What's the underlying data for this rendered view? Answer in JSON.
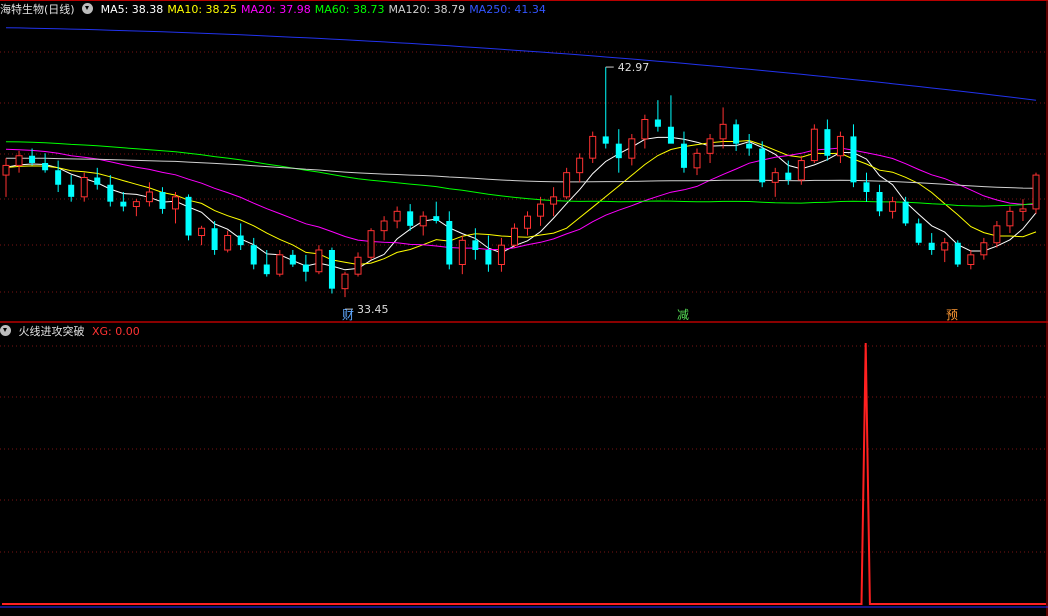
{
  "main_legend": {
    "stock": "海特生物(日线)",
    "items": [
      {
        "label": "MA5: 38.38",
        "color": "#ffffff"
      },
      {
        "label": "MA10: 38.25",
        "color": "#ffff00"
      },
      {
        "label": "MA20: 37.98",
        "color": "#ff00ff"
      },
      {
        "label": "MA60: 38.73",
        "color": "#00ff00"
      },
      {
        "label": "MA120: 38.79",
        "color": "#d0d0d0"
      },
      {
        "label": "MA250: 41.34",
        "color": "#3355ff"
      }
    ]
  },
  "sub_legend": {
    "indicator": "火线进攻突破",
    "value": "XG: 0.00",
    "value_color": "#ff3333"
  },
  "price_annotations": {
    "high": "42.97",
    "low": "33.45"
  },
  "event_markers": [
    {
      "label": "财",
      "color": "#5fa8ff"
    },
    {
      "label": "减",
      "color": "#55dd55"
    },
    {
      "label": "预",
      "color": "#ff9933"
    }
  ],
  "colors": {
    "up": "#ff3232",
    "down": "#00ffff",
    "grid": "#7a1515",
    "divider": "#b80000"
  },
  "chart_data": [
    {
      "type": "candlestick",
      "bars": 80,
      "ylim": [
        33.0,
        45.0
      ],
      "candles": [
        [
          38.5,
          39.2,
          37.6,
          38.9
        ],
        [
          38.9,
          39.5,
          38.6,
          39.3
        ],
        [
          39.3,
          39.6,
          38.9,
          39.0
        ],
        [
          39.0,
          39.4,
          38.6,
          38.7
        ],
        [
          38.7,
          39.1,
          37.8,
          38.1
        ],
        [
          38.1,
          38.5,
          37.4,
          37.6
        ],
        [
          37.6,
          38.6,
          37.4,
          38.4
        ],
        [
          38.4,
          38.8,
          37.9,
          38.1
        ],
        [
          38.1,
          38.5,
          37.2,
          37.4
        ],
        [
          37.4,
          37.8,
          37.0,
          37.2
        ],
        [
          37.2,
          37.5,
          36.8,
          37.4
        ],
        [
          37.4,
          38.2,
          37.2,
          37.8
        ],
        [
          37.8,
          38.0,
          36.9,
          37.1
        ],
        [
          37.1,
          37.8,
          36.5,
          37.6
        ],
        [
          37.6,
          37.7,
          35.8,
          36.0
        ],
        [
          36.0,
          36.4,
          35.6,
          36.3
        ],
        [
          36.3,
          36.6,
          35.2,
          35.4
        ],
        [
          35.4,
          36.2,
          35.3,
          36.0
        ],
        [
          36.0,
          36.5,
          35.4,
          35.6
        ],
        [
          35.6,
          35.9,
          34.6,
          34.8
        ],
        [
          34.8,
          35.4,
          34.3,
          34.4
        ],
        [
          34.4,
          35.4,
          34.3,
          35.2
        ],
        [
          35.2,
          35.4,
          34.7,
          34.8
        ],
        [
          34.8,
          35.2,
          34.1,
          34.5
        ],
        [
          34.5,
          35.6,
          34.4,
          35.4
        ],
        [
          35.4,
          35.5,
          33.6,
          33.8
        ],
        [
          33.8,
          34.5,
          33.45,
          34.4
        ],
        [
          34.4,
          35.3,
          34.3,
          35.1
        ],
        [
          35.1,
          36.3,
          35.0,
          36.2
        ],
        [
          36.2,
          36.8,
          35.8,
          36.6
        ],
        [
          36.6,
          37.2,
          36.3,
          37.0
        ],
        [
          37.0,
          37.3,
          36.2,
          36.4
        ],
        [
          36.4,
          37.0,
          36.0,
          36.8
        ],
        [
          36.8,
          37.4,
          36.5,
          36.6
        ],
        [
          36.6,
          37.0,
          34.6,
          34.8
        ],
        [
          34.8,
          36.0,
          34.4,
          35.8
        ],
        [
          35.8,
          36.3,
          35.0,
          35.4
        ],
        [
          35.4,
          36.0,
          34.5,
          34.8
        ],
        [
          34.8,
          35.9,
          34.5,
          35.6
        ],
        [
          35.6,
          36.5,
          35.5,
          36.3
        ],
        [
          36.3,
          37.0,
          36.0,
          36.8
        ],
        [
          36.8,
          37.6,
          36.4,
          37.3
        ],
        [
          37.3,
          38.0,
          36.8,
          37.6
        ],
        [
          37.6,
          38.8,
          37.5,
          38.6
        ],
        [
          38.6,
          39.4,
          38.2,
          39.2
        ],
        [
          39.2,
          40.3,
          39.0,
          40.1
        ],
        [
          40.1,
          42.97,
          39.6,
          39.8
        ],
        [
          39.8,
          40.4,
          38.6,
          39.2
        ],
        [
          39.2,
          40.2,
          38.9,
          40.0
        ],
        [
          40.0,
          41.0,
          39.6,
          40.8
        ],
        [
          40.8,
          41.6,
          40.3,
          40.5
        ],
        [
          40.5,
          41.8,
          40.0,
          39.8
        ],
        [
          39.8,
          40.3,
          38.6,
          38.8
        ],
        [
          38.8,
          39.6,
          38.5,
          39.4
        ],
        [
          39.4,
          40.2,
          39.0,
          40.0
        ],
        [
          40.0,
          41.3,
          39.6,
          40.6
        ],
        [
          40.6,
          40.8,
          39.5,
          39.8
        ],
        [
          39.8,
          40.2,
          39.3,
          39.6
        ],
        [
          39.6,
          39.9,
          38.0,
          38.2
        ],
        [
          38.2,
          38.8,
          37.6,
          38.6
        ],
        [
          38.6,
          39.1,
          38.1,
          38.3
        ],
        [
          38.3,
          39.3,
          38.1,
          39.1
        ],
        [
          39.1,
          40.6,
          39.0,
          40.4
        ],
        [
          40.4,
          40.8,
          39.1,
          39.3
        ],
        [
          39.3,
          40.3,
          39.0,
          40.1
        ],
        [
          40.1,
          40.6,
          38.0,
          38.2
        ],
        [
          38.2,
          38.6,
          37.4,
          37.8
        ],
        [
          37.8,
          38.1,
          36.8,
          37.0
        ],
        [
          37.0,
          37.6,
          36.7,
          37.4
        ],
        [
          37.4,
          37.6,
          36.4,
          36.5
        ],
        [
          36.5,
          36.7,
          35.6,
          35.7
        ],
        [
          35.7,
          36.1,
          35.2,
          35.4
        ],
        [
          35.4,
          35.9,
          34.9,
          35.7
        ],
        [
          35.7,
          35.8,
          34.7,
          34.8
        ],
        [
          34.8,
          35.4,
          34.6,
          35.2
        ],
        [
          35.2,
          35.9,
          35.0,
          35.7
        ],
        [
          35.7,
          36.6,
          35.5,
          36.4
        ],
        [
          36.4,
          37.2,
          36.1,
          37.0
        ],
        [
          37.0,
          37.5,
          36.6,
          37.1
        ],
        [
          37.1,
          38.6,
          36.9,
          38.5
        ]
      ]
    },
    {
      "type": "line",
      "series": [
        {
          "name": "XG",
          "values": [
            0,
            0,
            0,
            0,
            0,
            0,
            0,
            0,
            0,
            0,
            0,
            0,
            0,
            0,
            0,
            0,
            0,
            0,
            0,
            0,
            0,
            0,
            0,
            0,
            0,
            0,
            0,
            0,
            0,
            0,
            0,
            0,
            0,
            0,
            0,
            0,
            0,
            0,
            0,
            0,
            0,
            0,
            0,
            0,
            0,
            0,
            0,
            0,
            0,
            0,
            0,
            0,
            0,
            0,
            0,
            0,
            0,
            0,
            0,
            0,
            0,
            0,
            0,
            0,
            0,
            0,
            0,
            0,
            0,
            0,
            0,
            0,
            0,
            0,
            0,
            0,
            0,
            0,
            0,
            0,
            0,
            0,
            0,
            0,
            0,
            0,
            0,
            0,
            0,
            0,
            0,
            0,
            0,
            0,
            0,
            0,
            0,
            0,
            0,
            0,
            0,
            0,
            0,
            0,
            0,
            0,
            0,
            0,
            0,
            0,
            0,
            0,
            0,
            0,
            0,
            0,
            0,
            0,
            0,
            0,
            0,
            0,
            0,
            0,
            0,
            0,
            0,
            0,
            0,
            0,
            0,
            0,
            0,
            0,
            0,
            0,
            0,
            0,
            0,
            0,
            0,
            0,
            0,
            0,
            0,
            0,
            0,
            0,
            0,
            0,
            0,
            0,
            0,
            0,
            0,
            0,
            0,
            0,
            0,
            0,
            0,
            0,
            0,
            0,
            0,
            0,
            0,
            0,
            0,
            0,
            0,
            0,
            0,
            0,
            0,
            0,
            0,
            0,
            0,
            0,
            0,
            0,
            0,
            0,
            0,
            0,
            0,
            0,
            0,
            0,
            0,
            0,
            0,
            0,
            0,
            0,
            0,
            0,
            0,
            0,
            0,
            0,
            0,
            0,
            0,
            0,
            1,
            0,
            0,
            0,
            0,
            0,
            0,
            0,
            0,
            0,
            0,
            0,
            0,
            0,
            0,
            0,
            0,
            0,
            0,
            0,
            0,
            0,
            0,
            0,
            0,
            0,
            0,
            0,
            0,
            0,
            0,
            0,
            0,
            0,
            0,
            0,
            0,
            0,
            0,
            0,
            0,
            0,
            0,
            0
          ]
        }
      ],
      "ylim": [
        0,
        1
      ]
    }
  ]
}
